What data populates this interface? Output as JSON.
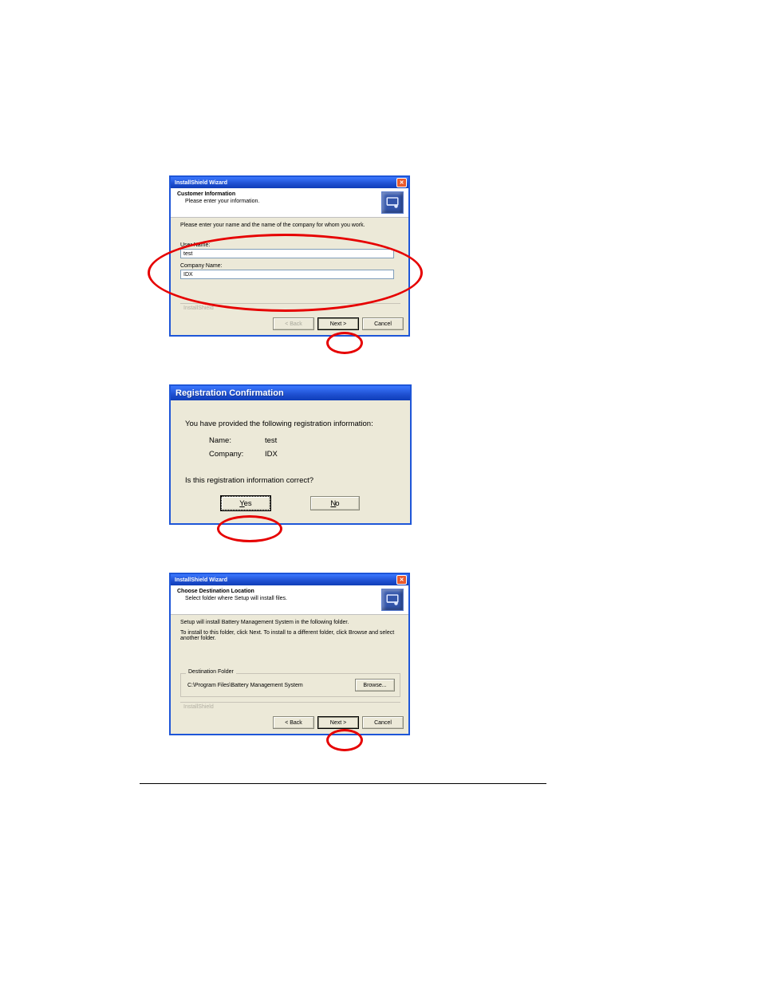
{
  "dialog1": {
    "title": "InstallShield Wizard",
    "header_title": "Customer Information",
    "header_sub": "Please enter your information.",
    "instruction": "Please enter your name and the name of the company for whom you work.",
    "user_name_label": "User Name:",
    "user_name_value": "test",
    "company_label": "Company Name:",
    "company_value": "IDX",
    "brand": "InstallShield",
    "back": "< Back",
    "next": "Next >",
    "cancel": "Cancel",
    "close_glyph": "✕"
  },
  "dialog2": {
    "title": "Registration Confirmation",
    "line1": "You have provided the following registration information:",
    "name_label": "Name:",
    "name_value": "test",
    "company_label": "Company:",
    "company_value": "IDX",
    "question": "Is this registration information correct?",
    "yes": "Yes",
    "no": "No"
  },
  "dialog3": {
    "title": "InstallShield Wizard",
    "header_title": "Choose Destination Location",
    "header_sub": "Select folder where Setup will install files.",
    "line1": "Setup will install Battery Management System in the following folder.",
    "line2": "To install to this folder, click Next. To install to a different folder, click Browse and select another folder.",
    "group_legend": "Destination Folder",
    "folder_path": "C:\\Program Files\\Battery Management System",
    "browse": "Browse...",
    "brand": "InstallShield",
    "back": "< Back",
    "next": "Next >",
    "cancel": "Cancel",
    "close_glyph": "✕"
  }
}
